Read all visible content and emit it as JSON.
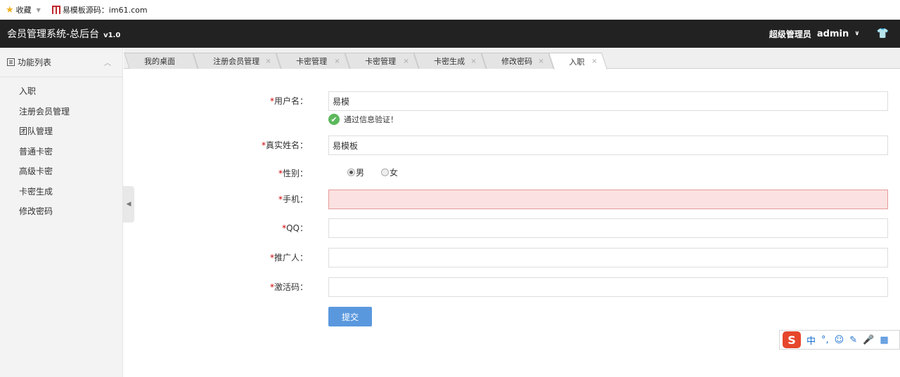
{
  "bookmarks": {
    "favorites_label": "收藏",
    "site_label": "易模板源码：im61.com"
  },
  "header": {
    "title": "会员管理系统-总后台",
    "version": "v1.0",
    "role": "超级管理员",
    "user": "admin"
  },
  "sidebar": {
    "title": "功能列表",
    "items": [
      {
        "label": "入职"
      },
      {
        "label": "注册会员管理"
      },
      {
        "label": "团队管理"
      },
      {
        "label": "普通卡密"
      },
      {
        "label": "高级卡密"
      },
      {
        "label": "卡密生成"
      },
      {
        "label": "修改密码"
      }
    ]
  },
  "tabs": [
    {
      "label": "我的桌面",
      "closable": false
    },
    {
      "label": "注册会员管理",
      "closable": true
    },
    {
      "label": "卡密管理",
      "closable": true
    },
    {
      "label": "卡密管理",
      "closable": true
    },
    {
      "label": "卡密生成",
      "closable": true
    },
    {
      "label": "修改密码",
      "closable": true
    },
    {
      "label": "入职",
      "closable": true,
      "active": true
    }
  ],
  "tab_close_glyph": "×",
  "form": {
    "required_mark": "*",
    "username": {
      "label": "用户名：",
      "value": "易模",
      "valid_msg": "通过信息验证！"
    },
    "realname": {
      "label": "真实姓名：",
      "value": "易模板"
    },
    "gender": {
      "label": "性别：",
      "options": [
        "男",
        "女"
      ],
      "selected": "男"
    },
    "phone": {
      "label": "手机：",
      "value": ""
    },
    "qq": {
      "label": "QQ：",
      "value": ""
    },
    "referrer": {
      "label": "推广人：",
      "value": ""
    },
    "activation": {
      "label": "激活码：",
      "value": ""
    },
    "submit_label": "提交"
  },
  "ime": {
    "logo": "S",
    "mode": "中",
    "punct": "°,"
  },
  "colors": {
    "header_bg": "#222222",
    "submit_bg": "#5a98de",
    "error_bg": "#fbe1e1",
    "valid_green": "#5cb85c"
  }
}
